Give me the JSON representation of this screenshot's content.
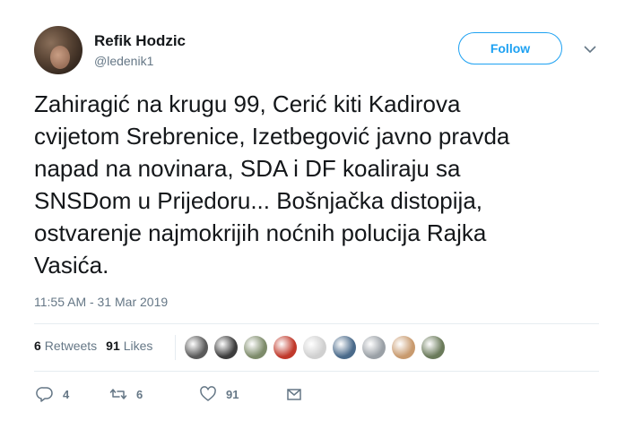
{
  "author": {
    "name": "Refik Hodzic",
    "handle": "@ledenik1"
  },
  "follow_button": {
    "label": "Follow"
  },
  "tweet": {
    "lines": [
      "Zahiragić na krugu 99, Cerić kiti Kadirova",
      "cvijetom Srebrenice, Izetbegović javno pravda",
      "napad na novinara, SDA i DF koaliraju sa",
      "SNSDom u Prijedoru... Bošnjačka distopija,",
      "ostvarenje najmokrijih noćnih polucija Rajka",
      "Vasića."
    ],
    "timestamp": "11:55 AM - 31 Mar 2019"
  },
  "stats": {
    "retweets_count": "6",
    "retweets_label": "Retweets",
    "likes_count": "91",
    "likes_label": "Likes"
  },
  "likers": [
    {
      "icon": "liker-avatar-1",
      "color": "#5a5a5a"
    },
    {
      "icon": "liker-avatar-2",
      "color": "#3d3d3d"
    },
    {
      "icon": "liker-avatar-3",
      "color": "#7d8b6a"
    },
    {
      "icon": "liker-avatar-4",
      "color": "#c0392b"
    },
    {
      "icon": "liker-avatar-5",
      "color": "#d0d0d0"
    },
    {
      "icon": "liker-avatar-6",
      "color": "#4a6a8a"
    },
    {
      "icon": "liker-avatar-7",
      "color": "#9aa0a6"
    },
    {
      "icon": "liker-avatar-8",
      "color": "#c89a6e"
    },
    {
      "icon": "liker-avatar-9",
      "color": "#6a7a5a"
    }
  ],
  "actions": {
    "replies": "4",
    "retweets": "6",
    "likes": "91"
  },
  "colors": {
    "accent": "#1da1f2",
    "secondary_text": "#657786",
    "divider": "#e6ecf0"
  }
}
